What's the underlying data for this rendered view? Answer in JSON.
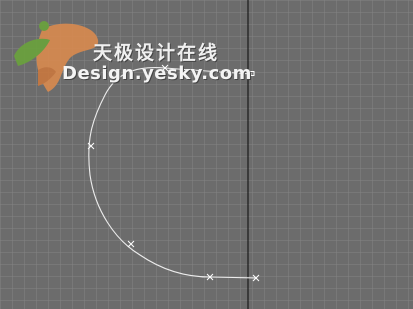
{
  "watermark": {
    "title_cn": "天极设计在线",
    "url": "Design.yesky.com"
  },
  "colors": {
    "background": "#6c6c6c",
    "grid": "#828282",
    "spline": "#ececec",
    "axis_line": "#1a1a1a",
    "logo_orange": "#d98a4f",
    "logo_green": "#6aa33c"
  },
  "icons": {
    "logo": "yesky-leaf-logo",
    "vertex_marker": "x-mark",
    "first_vertex": "square-mark"
  }
}
